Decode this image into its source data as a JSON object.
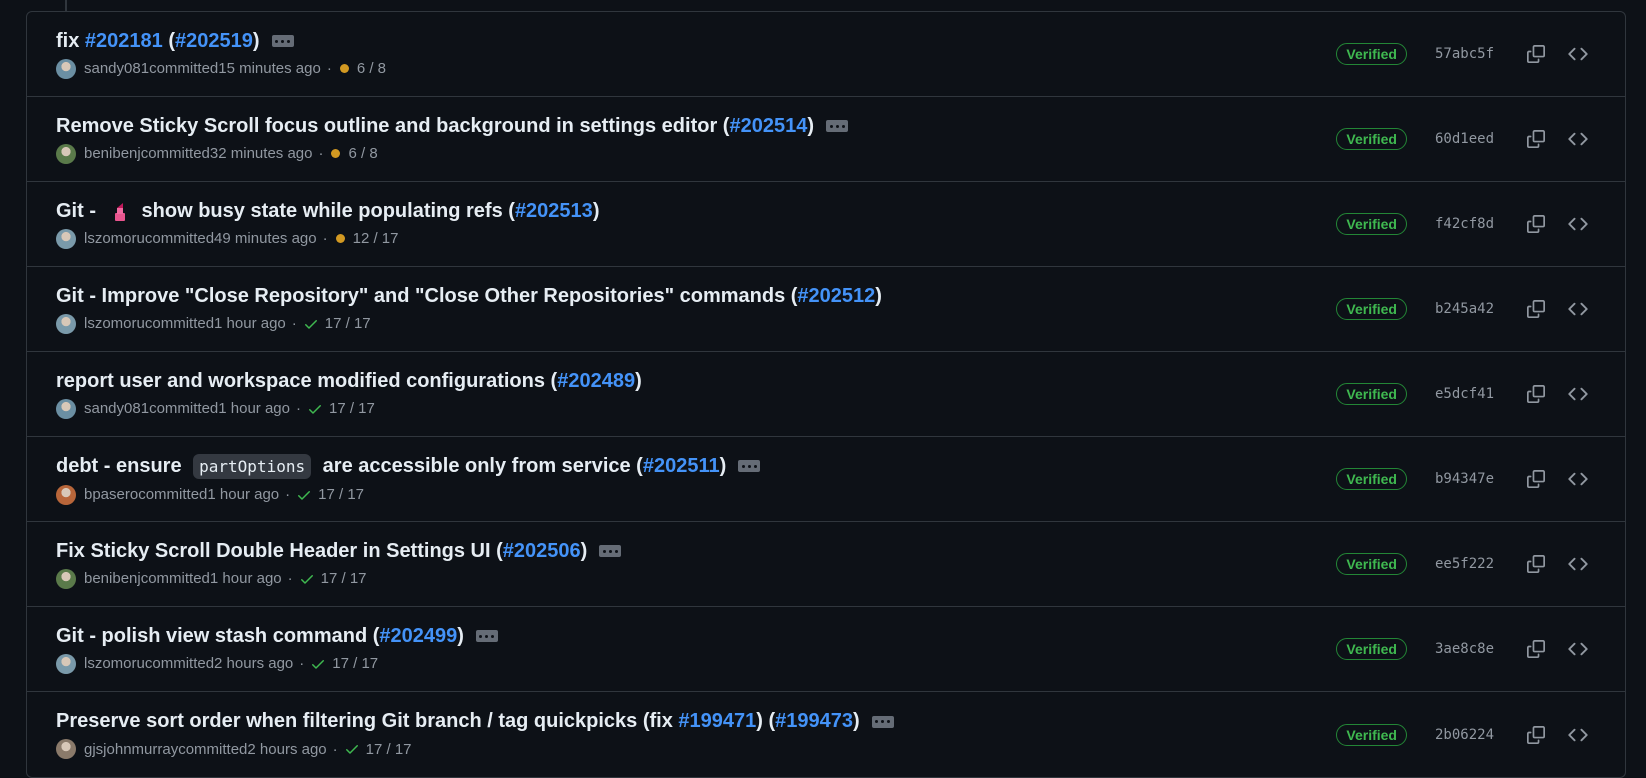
{
  "commits": [
    {
      "title_parts": [
        {
          "t": "text",
          "v": "fix "
        },
        {
          "t": "link",
          "v": "#202181"
        },
        {
          "t": "text",
          "v": " ("
        },
        {
          "t": "link",
          "v": "#202519"
        },
        {
          "t": "text",
          "v": ")"
        }
      ],
      "has_ellipsis": true,
      "author": "sandy081",
      "action": "committed",
      "time": "15 minutes ago",
      "status": "pending",
      "checks": "6 / 8",
      "verified": "Verified",
      "sha": "57abc5f",
      "avatar_color": "#6b8fa3"
    },
    {
      "title_parts": [
        {
          "t": "text",
          "v": "Remove Sticky Scroll focus outline and background in settings editor ("
        },
        {
          "t": "link",
          "v": "#202514"
        },
        {
          "t": "text",
          "v": ")"
        }
      ],
      "has_ellipsis": true,
      "author": "benibenj",
      "action": "committed",
      "time": "32 minutes ago",
      "status": "pending",
      "checks": "6 / 8",
      "verified": "Verified",
      "sha": "60d1eed",
      "avatar_color": "#5a7a4a"
    },
    {
      "title_parts": [
        {
          "t": "text",
          "v": "Git - "
        },
        {
          "t": "emoji",
          "v": "lipstick"
        },
        {
          "t": "text",
          "v": "show busy state while populating refs ("
        },
        {
          "t": "link",
          "v": "#202513"
        },
        {
          "t": "text",
          "v": ")"
        }
      ],
      "has_ellipsis": false,
      "author": "lszomoru",
      "action": "committed",
      "time": "49 minutes ago",
      "status": "pending",
      "checks": "12 / 17",
      "verified": "Verified",
      "sha": "f42cf8d",
      "avatar_color": "#7a9aaa"
    },
    {
      "title_parts": [
        {
          "t": "text",
          "v": "Git - Improve \"Close Repository\" and \"Close Other Repositories\" commands ("
        },
        {
          "t": "link",
          "v": "#202512"
        },
        {
          "t": "text",
          "v": ")"
        }
      ],
      "has_ellipsis": false,
      "author": "lszomoru",
      "action": "committed",
      "time": "1 hour ago",
      "status": "success",
      "checks": "17 / 17",
      "verified": "Verified",
      "sha": "b245a42",
      "avatar_color": "#7a9aaa"
    },
    {
      "title_parts": [
        {
          "t": "text",
          "v": "report user and workspace modified configurations ("
        },
        {
          "t": "link",
          "v": "#202489"
        },
        {
          "t": "text",
          "v": ")"
        }
      ],
      "has_ellipsis": false,
      "author": "sandy081",
      "action": "committed",
      "time": "1 hour ago",
      "status": "success",
      "checks": "17 / 17",
      "verified": "Verified",
      "sha": "e5dcf41",
      "avatar_color": "#6b8fa3"
    },
    {
      "title_parts": [
        {
          "t": "text",
          "v": "debt - ensure "
        },
        {
          "t": "code",
          "v": "partOptions"
        },
        {
          "t": "text",
          "v": " are accessible only from service ("
        },
        {
          "t": "link",
          "v": "#202511"
        },
        {
          "t": "text",
          "v": ")"
        }
      ],
      "has_ellipsis": true,
      "author": "bpasero",
      "action": "committed",
      "time": "1 hour ago",
      "status": "success",
      "checks": "17 / 17",
      "verified": "Verified",
      "sha": "b94347e",
      "avatar_color": "#b8663a"
    },
    {
      "title_parts": [
        {
          "t": "text",
          "v": "Fix Sticky Scroll Double Header in Settings UI ("
        },
        {
          "t": "link",
          "v": "#202506"
        },
        {
          "t": "text",
          "v": ")"
        }
      ],
      "has_ellipsis": true,
      "author": "benibenj",
      "action": "committed",
      "time": "1 hour ago",
      "status": "success",
      "checks": "17 / 17",
      "verified": "Verified",
      "sha": "ee5f222",
      "avatar_color": "#5a7a4a"
    },
    {
      "title_parts": [
        {
          "t": "text",
          "v": "Git - polish view stash command ("
        },
        {
          "t": "link",
          "v": "#202499"
        },
        {
          "t": "text",
          "v": ")"
        }
      ],
      "has_ellipsis": true,
      "author": "lszomoru",
      "action": "committed",
      "time": "2 hours ago",
      "status": "success",
      "checks": "17 / 17",
      "verified": "Verified",
      "sha": "3ae8c8e",
      "avatar_color": "#7a9aaa"
    },
    {
      "title_parts": [
        {
          "t": "text",
          "v": "Preserve sort order when filtering Git branch / tag quickpicks (fix "
        },
        {
          "t": "link",
          "v": "#199471"
        },
        {
          "t": "text",
          "v": ") ("
        },
        {
          "t": "link",
          "v": "#199473"
        },
        {
          "t": "text",
          "v": ")"
        }
      ],
      "has_ellipsis": true,
      "author": "gjsjohnmurray",
      "action": "committed",
      "time": "2 hours ago",
      "status": "success",
      "checks": "17 / 17",
      "verified": "Verified",
      "sha": "2b06224",
      "avatar_color": "#8a7a6a"
    }
  ],
  "colors": {
    "bg": "#0d1117",
    "border": "#30363d",
    "link": "#4493f8",
    "verified": "#3fb950",
    "pending": "#d29922",
    "muted": "#9198a1"
  },
  "icons": {
    "copy": "copy-icon",
    "browse": "code-icon",
    "check": "check-icon",
    "pending": "dot-fill-icon"
  }
}
